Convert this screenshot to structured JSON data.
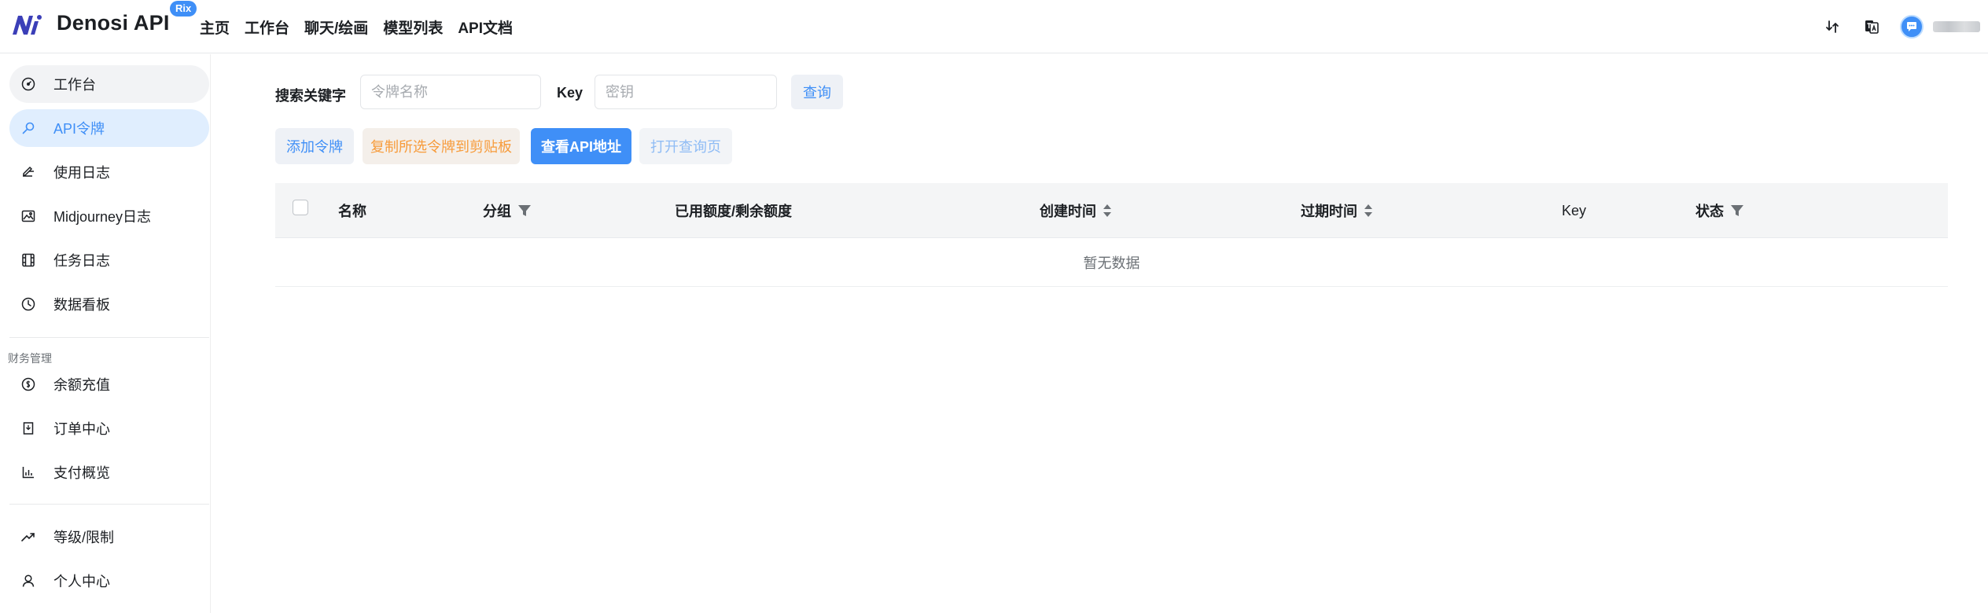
{
  "brand": {
    "name": "Denosi API",
    "badge": "Rix"
  },
  "nav": [
    "主页",
    "工作台",
    "聊天/绘画",
    "模型列表",
    "API文档"
  ],
  "sidebar": {
    "items": [
      {
        "label": "工作台",
        "icon": "dashboard-icon"
      },
      {
        "label": "API令牌",
        "icon": "key-icon"
      },
      {
        "label": "使用日志",
        "icon": "log-icon"
      },
      {
        "label": "Midjourney日志",
        "icon": "image-icon"
      },
      {
        "label": "任务日志",
        "icon": "film-icon"
      },
      {
        "label": "数据看板",
        "icon": "clock-icon"
      }
    ],
    "finance_section": "财务管理",
    "finance_items": [
      {
        "label": "余额充值",
        "icon": "coin-icon"
      },
      {
        "label": "订单中心",
        "icon": "order-icon"
      },
      {
        "label": "支付概览",
        "icon": "bar-chart-icon"
      }
    ],
    "bottom_items": [
      {
        "label": "等级/限制",
        "icon": "trend-icon"
      },
      {
        "label": "个人中心",
        "icon": "user-icon"
      }
    ]
  },
  "search": {
    "keyword_label": "搜索关键字",
    "keyword_placeholder": "令牌名称",
    "key_label": "Key",
    "key_placeholder": "密钥",
    "query_button": "查询"
  },
  "actions": {
    "add": "添加令牌",
    "copy": "复制所选令牌到剪贴板",
    "view_api": "查看API地址",
    "open_query": "打开查询页"
  },
  "table": {
    "columns": {
      "name": "名称",
      "group": "分组",
      "quota": "已用额度/剩余额度",
      "created": "创建时间",
      "expire": "过期时间",
      "key": "Key",
      "status": "状态"
    },
    "empty_text": "暂无数据"
  },
  "colors": {
    "accent": "#3f8ff7",
    "warning": "#f79b3a",
    "active_bg": "#e0eefe"
  }
}
